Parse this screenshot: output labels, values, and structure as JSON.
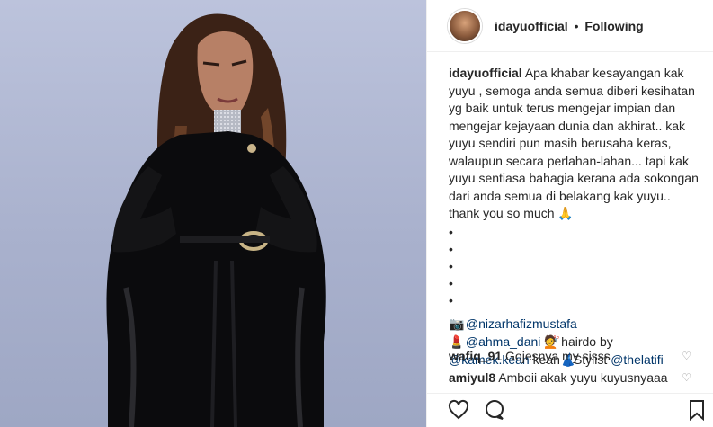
{
  "post": {
    "username": "idayuofficial",
    "separator": "•",
    "follow_status": "Following",
    "caption": {
      "username": "idayuofficial",
      "text": "Apa khabar kesayangan kak yuyu , semoga anda semua diberi kesihatan yg baik untuk terus mengejar impian dan mengejar kejayaan dunia dan akhirat.. kak yuyu sendiri pun masih berusaha keras, walaupun secara perlahan-lahan... tapi kak yuyu sentiasa bahagia kerana ada sokongan dari anda semua di belakang kak yuyu.. thank you so much 🙏",
      "bullets": [
        "•",
        "•",
        "•",
        "•",
        "•"
      ],
      "credits": {
        "camera_emoji": "📷",
        "photographer": "@nizarhafizmustafa",
        "lipstick_emoji": "💄",
        "makeup": "@ahma_dani",
        "haircut_emoji": "💇",
        "hair_label": "hairdo by",
        "hair_artist": "@kamek.kean",
        "hair_suffix": "kean",
        "dress_emoji": "👗",
        "stylist_label": "Stylist",
        "stylist": "@thelatifi"
      }
    },
    "comments": [
      {
        "username": "wafiq_91",
        "text": "Gojesnya my sisss"
      },
      {
        "username": "amiyul8",
        "text": "Amboii akak yuyu kuyusnyaaa"
      }
    ]
  },
  "icons": {
    "like": "heart-icon",
    "comment": "comment-icon",
    "save": "bookmark-icon"
  }
}
